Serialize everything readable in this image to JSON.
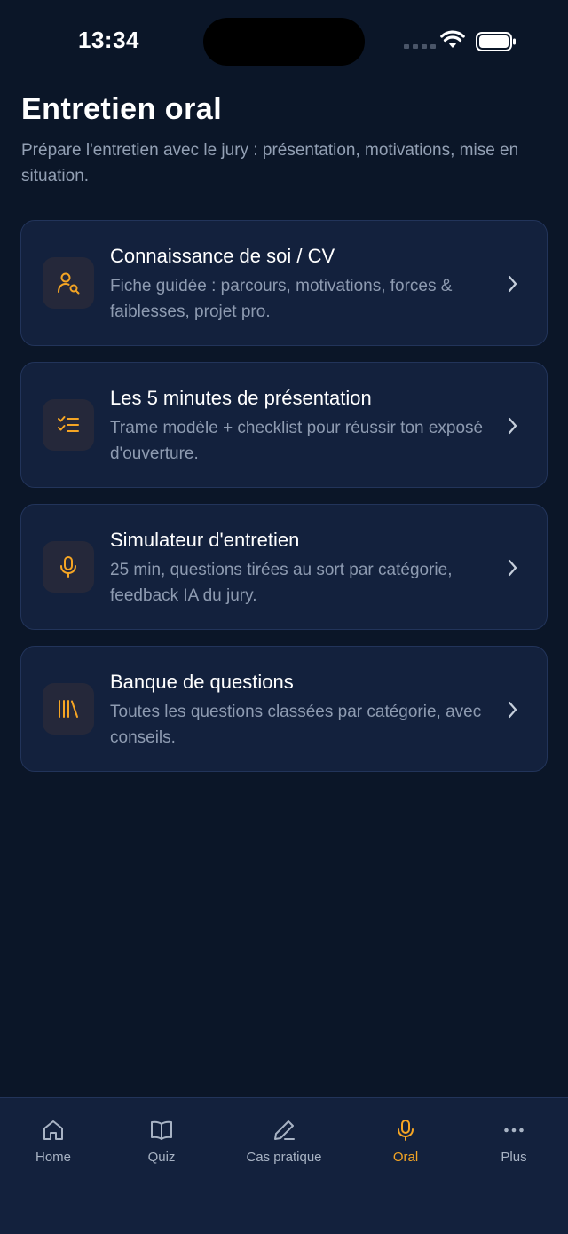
{
  "status_bar": {
    "time": "13:34"
  },
  "header": {
    "title": "Entretien oral",
    "subtitle": "Prépare l'entretien avec le jury : présentation, motivations, mise en situation."
  },
  "cards": [
    {
      "title": "Connaissance de soi / CV",
      "description": "Fiche guidée : parcours, motivations, forces & faiblesses, projet pro.",
      "icon": "user-search-icon"
    },
    {
      "title": "Les 5 minutes de présentation",
      "description": "Trame modèle + checklist pour réussir ton exposé d'ouverture.",
      "icon": "checklist-icon"
    },
    {
      "title": "Simulateur d'entretien",
      "description": "25 min, questions tirées au sort par catégorie, feedback IA du jury.",
      "icon": "microphone-icon"
    },
    {
      "title": "Banque de questions",
      "description": "Toutes les questions classées par catégorie, avec conseils.",
      "icon": "library-icon"
    }
  ],
  "tab_bar": {
    "active": "Oral",
    "items": [
      {
        "label": "Home",
        "icon": "home-icon"
      },
      {
        "label": "Quiz",
        "icon": "book-icon"
      },
      {
        "label": "Cas pratique",
        "icon": "pencil-icon"
      },
      {
        "label": "Oral",
        "icon": "microphone-icon"
      },
      {
        "label": "Plus",
        "icon": "more-icon"
      }
    ]
  },
  "colors": {
    "background": "#0b1628",
    "card": "#13213d",
    "card_border": "#22345a",
    "accent": "#f5a524",
    "text_muted": "#8e9bb1"
  }
}
